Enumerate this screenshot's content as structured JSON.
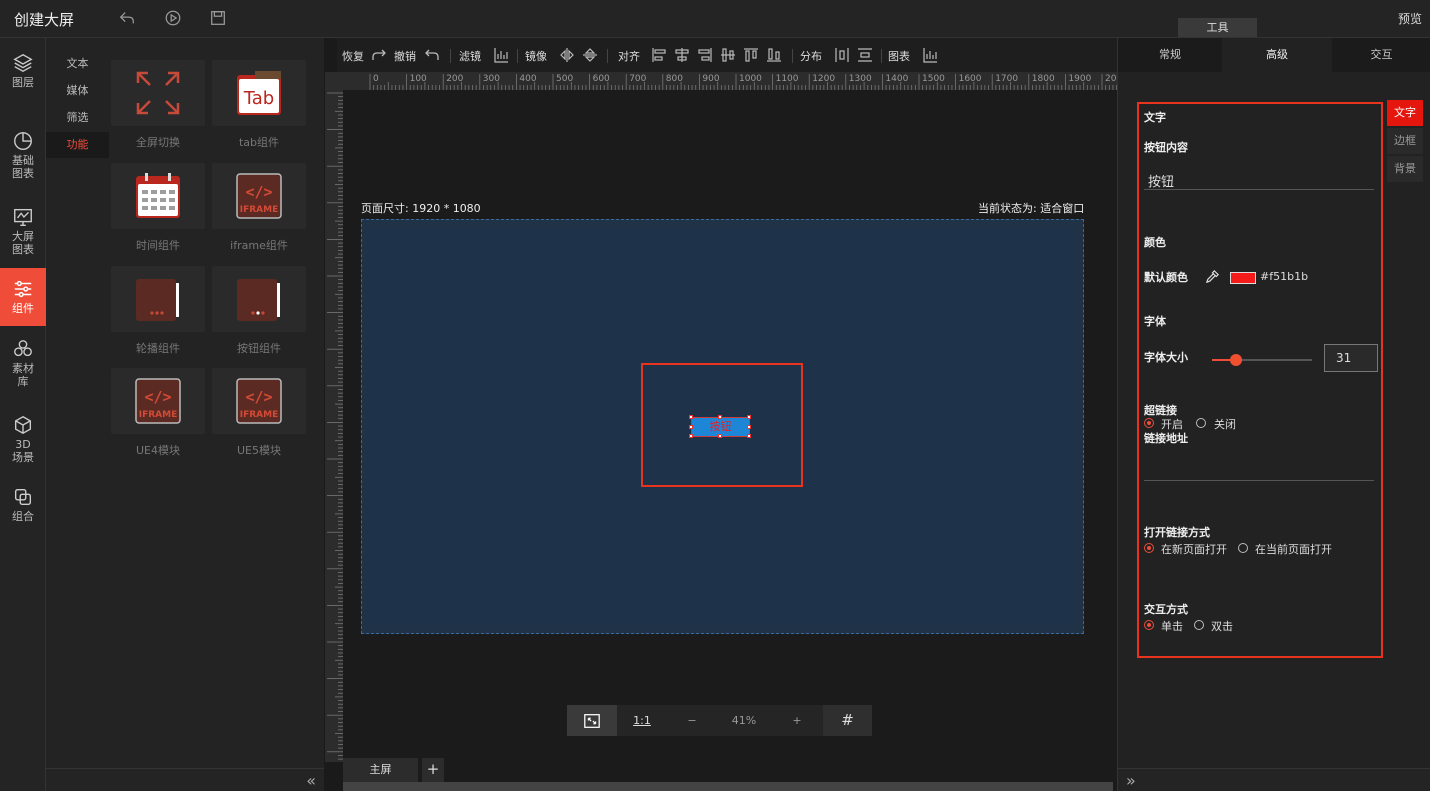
{
  "header": {
    "title": "创建大屏",
    "preview": "预览",
    "tools": "工具"
  },
  "left_rail": [
    {
      "label": "图层",
      "icon": "layers-icon"
    },
    {
      "label": "基础\n图表",
      "icon": "pie-chart-icon"
    },
    {
      "label": "大屏\n图表",
      "icon": "monitor-chart-icon"
    },
    {
      "label": "组件",
      "icon": "sliders-icon",
      "active": true
    },
    {
      "label": "素材\n库",
      "icon": "hexagons-icon"
    },
    {
      "label": "3D\n场景",
      "icon": "cube-icon"
    },
    {
      "label": "组合",
      "icon": "group-icon"
    }
  ],
  "categories": [
    "文本",
    "媒体",
    "筛选",
    "功能"
  ],
  "active_category": "功能",
  "components": [
    {
      "label": "全屏切换",
      "icon": "fullscreen-icon"
    },
    {
      "label": "tab组件",
      "icon": "tab-icon",
      "icon_text": "Tab"
    },
    {
      "label": "时间组件",
      "icon": "calendar-icon"
    },
    {
      "label": "iframe组件",
      "icon": "iframe-icon",
      "icon_text": "IFRAME"
    },
    {
      "label": "轮播组件",
      "icon": "carousel-icon"
    },
    {
      "label": "按钮组件",
      "icon": "button-component-icon"
    },
    {
      "label": "UE4模块",
      "icon": "ue4-icon",
      "icon_text": "IFRAME"
    },
    {
      "label": "UE5模块",
      "icon": "ue5-icon",
      "icon_text": "IFRAME"
    }
  ],
  "toolbar": {
    "restore": "恢复",
    "undo": "撤销",
    "filter": "滤镜",
    "mirror": "镜像",
    "align": "对齐",
    "distribute": "分布",
    "chart": "图表"
  },
  "ruler_labels": [
    "0",
    "100",
    "200",
    "300",
    "400",
    "500",
    "600",
    "700",
    "800",
    "900",
    "1000",
    "1100",
    "1200",
    "1300",
    "1400",
    "1500",
    "1600",
    "1700",
    "1800",
    "1900",
    "20"
  ],
  "canvas": {
    "page_size": "页面尺寸: 1920 * 1080",
    "current_state": "当前状态为: 适合窗口",
    "button_text": "按钮"
  },
  "zoom": {
    "fit": "⤢",
    "one_to_one": "1:1",
    "minus": "−",
    "level": "41%",
    "plus": "+",
    "grid": "#"
  },
  "pages": {
    "main": "主屏",
    "add": "+"
  },
  "right": {
    "tabs": [
      "常规",
      "高级",
      "交互"
    ],
    "active_tab": "高级",
    "side_tabs": [
      "文字",
      "边框",
      "背景"
    ],
    "section_text": "文字",
    "button_content_label": "按钮内容",
    "button_content_value": "按钮",
    "color_section": "颜色",
    "default_color_label": "默认颜色",
    "default_color_value": "#f51b1b",
    "font_section": "字体",
    "font_size_label": "字体大小",
    "font_size_value": "31",
    "font_size_fraction": 0.24,
    "hyperlink_label": "超链接",
    "hyperlink_on": "开启",
    "hyperlink_off": "关闭",
    "link_address_label": "链接地址",
    "open_mode_label": "打开链接方式",
    "open_new": "在新页面打开",
    "open_current": "在当前页面打开",
    "interaction_label": "交互方式",
    "single_click": "单击",
    "double_click": "双击"
  },
  "colors": {
    "accent": "#f04c3a",
    "highlight": "#e8331f",
    "button_bg": "#1d86d6",
    "button_text": "#f51b1b"
  }
}
